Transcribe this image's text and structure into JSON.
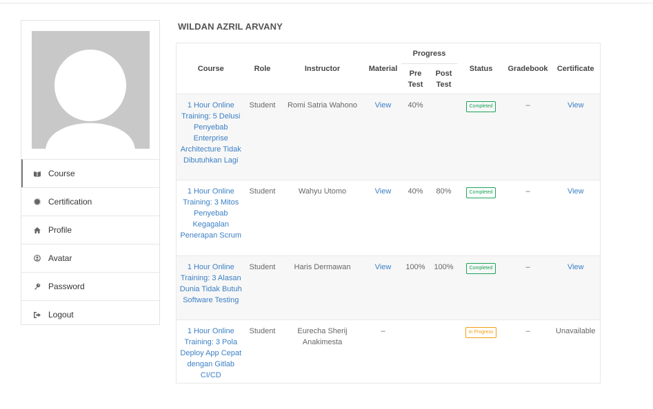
{
  "user": {
    "name": "WILDAN AZRIL ARVANY"
  },
  "sidebar": {
    "items": [
      {
        "label": "Course",
        "icon": "book-icon",
        "active": true
      },
      {
        "label": "Certification",
        "icon": "certificate-icon"
      },
      {
        "label": "Profile",
        "icon": "home-icon"
      },
      {
        "label": "Avatar",
        "icon": "user-circle-icon"
      },
      {
        "label": "Password",
        "icon": "key-icon"
      },
      {
        "label": "Logout",
        "icon": "sign-out-icon"
      }
    ]
  },
  "table": {
    "headers": {
      "course": "Course",
      "role": "Role",
      "instructor": "Instructor",
      "material": "Material",
      "progress": "Progress",
      "pre_test": "Pre Test",
      "post_test": "Post Test",
      "status": "Status",
      "gradebook": "Gradebook",
      "certificate": "Certificate"
    },
    "rows": [
      {
        "course": "1 Hour Online Training: 5 Delusi Penyebab Enterprise Architecture Tidak Dibutuhkan Lagi",
        "role": "Student",
        "instructor": "Romi Satria Wahono",
        "material": "View",
        "pre_test": "40%",
        "post_test": "",
        "status": "Completed",
        "gradebook": "–",
        "certificate": "View"
      },
      {
        "course": "1 Hour Online Training: 3 Mitos Penyebab Kegagalan Penerapan Scrum",
        "role": "Student",
        "instructor": "Wahyu Utomo",
        "material": "View",
        "pre_test": "40%",
        "post_test": "80%",
        "status": "Completed",
        "gradebook": "–",
        "certificate": "View"
      },
      {
        "course": "1 Hour Online Training: 3 Alasan Dunia Tidak Butuh Software Testing",
        "role": "Student",
        "instructor": "Haris Dermawan",
        "material": "View",
        "pre_test": "100%",
        "post_test": "100%",
        "status": "Completed",
        "gradebook": "–",
        "certificate": "View"
      },
      {
        "course": "1 Hour Online Training: 3 Pola Deploy App Cepat dengan Gitlab CI/CD",
        "role": "Student",
        "instructor": "Eurecha Sherij Anakimesta",
        "material": "–",
        "pre_test": "",
        "post_test": "",
        "status": "In Progress",
        "gradebook": "–",
        "certificate": "Unavailable"
      }
    ]
  },
  "colors": {
    "link": "#3b7fc4",
    "completed": "#1aa358",
    "in_progress": "#f0a012"
  }
}
